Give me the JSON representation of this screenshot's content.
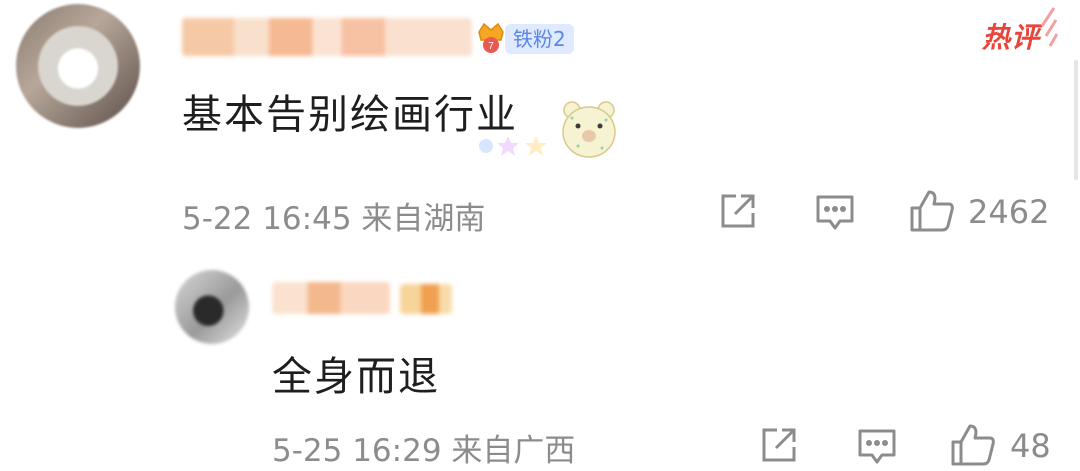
{
  "comment": {
    "badge_label": "铁粉2",
    "hot_label": "热评",
    "text": "基本告别绘画行业",
    "date": "5-22 16:45",
    "location": "来自湖南",
    "like_count": "2462"
  },
  "reply": {
    "text": "全身而退",
    "date": "5-25 16:29",
    "location": "来自广西",
    "like_count": "48"
  },
  "colors": {
    "hot_red": "#e8463b",
    "badge_blue": "#5b86e5",
    "meta_gray": "#8c8c8c"
  },
  "icons": [
    "crown-icon",
    "share-icon",
    "reply-icon",
    "thumbs-up-icon",
    "bear-sticker"
  ]
}
